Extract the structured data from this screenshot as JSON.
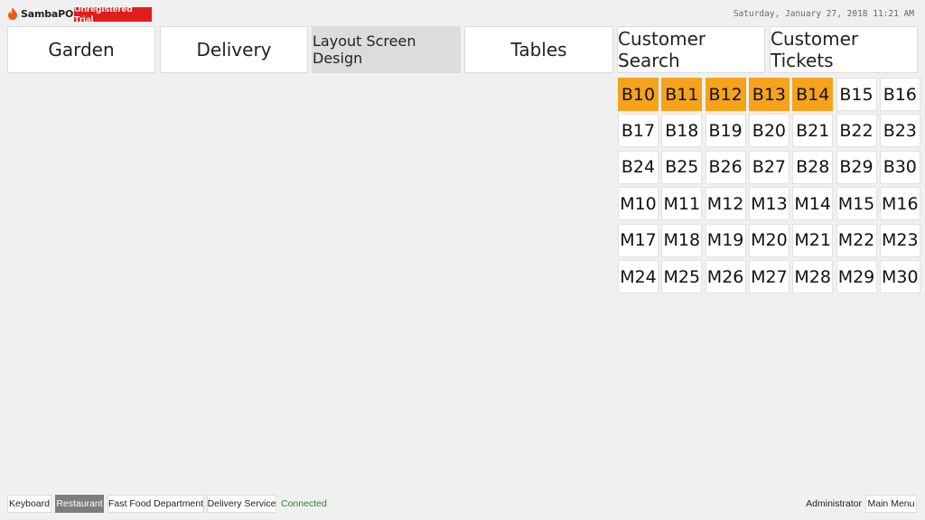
{
  "app": {
    "name": "SambaPOS",
    "trial_label": "Unregistered Trial",
    "datetime": "Saturday, January 27, 2018 11:21 AM",
    "accent_color": "#e31b1b"
  },
  "nav": {
    "buttons": [
      {
        "label": "Garden",
        "active": false
      },
      {
        "label": "Delivery",
        "active": false
      },
      {
        "label": "Layout Screen Design",
        "active": true
      },
      {
        "label": "Tables",
        "active": false
      },
      {
        "label": "Customer Search",
        "active": false
      },
      {
        "label": "Customer Tickets",
        "active": false
      }
    ]
  },
  "tables": {
    "occupied_color": "#f5a31a",
    "rows": [
      [
        {
          "label": "B10",
          "occupied": true
        },
        {
          "label": "B11",
          "occupied": true
        },
        {
          "label": "B12",
          "occupied": true
        },
        {
          "label": "B13",
          "occupied": true
        },
        {
          "label": "B14",
          "occupied": true
        },
        {
          "label": "B15",
          "occupied": false
        },
        {
          "label": "B16",
          "occupied": false
        }
      ],
      [
        {
          "label": "B17",
          "occupied": false
        },
        {
          "label": "B18",
          "occupied": false
        },
        {
          "label": "B19",
          "occupied": false
        },
        {
          "label": "B20",
          "occupied": false
        },
        {
          "label": "B21",
          "occupied": false
        },
        {
          "label": "B22",
          "occupied": false
        },
        {
          "label": "B23",
          "occupied": false
        }
      ],
      [
        {
          "label": "B24",
          "occupied": false
        },
        {
          "label": "B25",
          "occupied": false
        },
        {
          "label": "B26",
          "occupied": false
        },
        {
          "label": "B27",
          "occupied": false
        },
        {
          "label": "B28",
          "occupied": false
        },
        {
          "label": "B29",
          "occupied": false
        },
        {
          "label": "B30",
          "occupied": false
        }
      ],
      [
        {
          "label": "M10",
          "occupied": false
        },
        {
          "label": "M11",
          "occupied": false
        },
        {
          "label": "M12",
          "occupied": false
        },
        {
          "label": "M13",
          "occupied": false
        },
        {
          "label": "M14",
          "occupied": false
        },
        {
          "label": "M15",
          "occupied": false
        },
        {
          "label": "M16",
          "occupied": false
        }
      ],
      [
        {
          "label": "M17",
          "occupied": false
        },
        {
          "label": "M18",
          "occupied": false
        },
        {
          "label": "M19",
          "occupied": false
        },
        {
          "label": "M20",
          "occupied": false
        },
        {
          "label": "M21",
          "occupied": false
        },
        {
          "label": "M22",
          "occupied": false
        },
        {
          "label": "M23",
          "occupied": false
        }
      ],
      [
        {
          "label": "M24",
          "occupied": false
        },
        {
          "label": "M25",
          "occupied": false
        },
        {
          "label": "M26",
          "occupied": false
        },
        {
          "label": "M27",
          "occupied": false
        },
        {
          "label": "M28",
          "occupied": false
        },
        {
          "label": "M29",
          "occupied": false
        },
        {
          "label": "M30",
          "occupied": false
        }
      ]
    ]
  },
  "footer": {
    "keyboard": "Keyboard",
    "restaurant": "Restaurant",
    "fast_food": "Fast Food Department",
    "delivery_service": "Delivery Service",
    "status": "Connected",
    "user": "Administrator",
    "main_menu": "Main Menu"
  }
}
